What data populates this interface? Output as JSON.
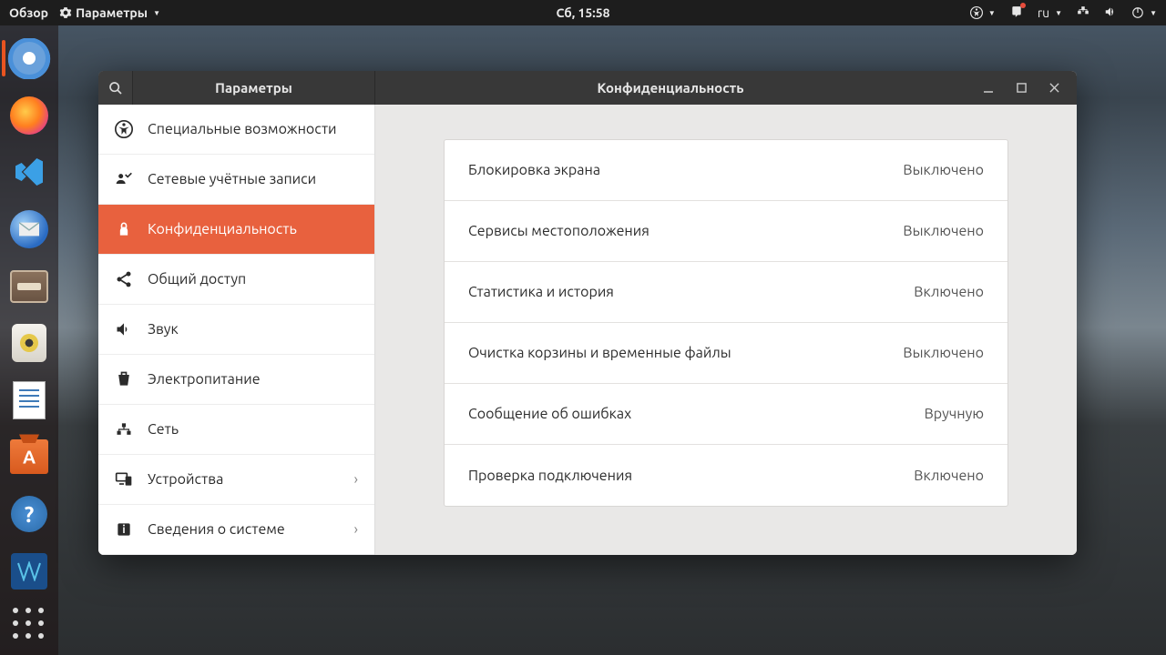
{
  "topbar": {
    "activities": "Обзор",
    "app_name": "Параметры",
    "clock": "Сб, 15:58",
    "lang": "ru"
  },
  "dock": {
    "apps": [
      "chromium",
      "firefox",
      "vscode",
      "thunderbird",
      "files",
      "rhythmbox",
      "libreoffice-writer",
      "software",
      "help",
      "virtualbox"
    ]
  },
  "window": {
    "sidebar_title": "Параметры",
    "panel_title": "Конфиденциальность",
    "sidebar": [
      {
        "label": "Специальные возможности",
        "icon": "accessibility",
        "selected": false,
        "chevron": false
      },
      {
        "label": "Сетевые учётные записи",
        "icon": "accounts",
        "selected": false,
        "chevron": false
      },
      {
        "label": "Конфиденциальность",
        "icon": "privacy",
        "selected": true,
        "chevron": false
      },
      {
        "label": "Общий доступ",
        "icon": "sharing",
        "selected": false,
        "chevron": false
      },
      {
        "label": "Звук",
        "icon": "sound",
        "selected": false,
        "chevron": false
      },
      {
        "label": "Электропитание",
        "icon": "power",
        "selected": false,
        "chevron": false
      },
      {
        "label": "Сеть",
        "icon": "network",
        "selected": false,
        "chevron": false
      },
      {
        "label": "Устройства",
        "icon": "devices",
        "selected": false,
        "chevron": true
      },
      {
        "label": "Сведения о системе",
        "icon": "info",
        "selected": false,
        "chevron": true
      }
    ],
    "rows": [
      {
        "label": "Блокировка экрана",
        "status": "Выключено"
      },
      {
        "label": "Сервисы местоположения",
        "status": "Выключено"
      },
      {
        "label": "Статистика и история",
        "status": "Включено"
      },
      {
        "label": "Очистка корзины и временные файлы",
        "status": "Выключено"
      },
      {
        "label": "Сообщение об ошибках",
        "status": "Вручную"
      },
      {
        "label": "Проверка подключения",
        "status": "Включено"
      }
    ]
  }
}
